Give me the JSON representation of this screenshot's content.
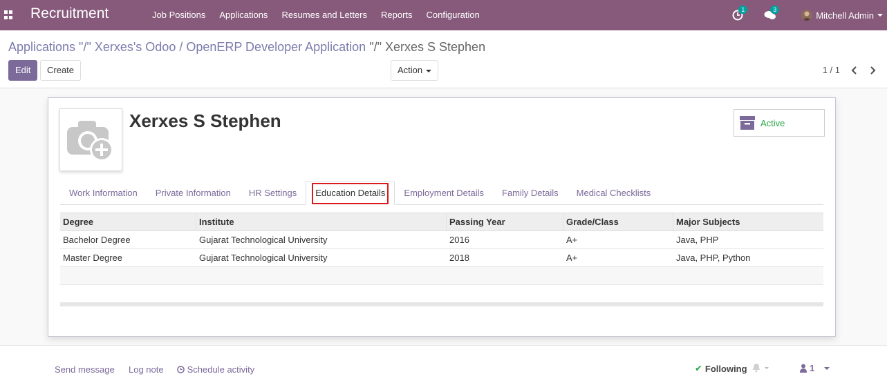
{
  "navbar": {
    "brand": "Recruitment",
    "menu": [
      "Job Positions",
      "Applications",
      "Resumes and Letters",
      "Reports",
      "Configuration"
    ],
    "activity_count": "1",
    "message_count": "3",
    "user": "Mitchell Admin"
  },
  "breadcrumb": {
    "part1": "Applications \"/\" Xerxes's Odoo / OpenERP Developer Application",
    "sep": "\"/\"",
    "current": "Xerxes S Stephen"
  },
  "buttons": {
    "edit": "Edit",
    "create": "Create",
    "action": "Action"
  },
  "pager": {
    "value": "1 / 1"
  },
  "record": {
    "name": "Xerxes S Stephen",
    "status": "Active"
  },
  "tabs": [
    "Work Information",
    "Private Information",
    "HR Settings",
    "Education Details",
    "Employment Details",
    "Family Details",
    "Medical Checklists"
  ],
  "table": {
    "headers": [
      "Degree",
      "Institute",
      "Passing Year",
      "Grade/Class",
      "Major Subjects"
    ],
    "rows": [
      [
        "Bachelor Degree",
        "Gujarat Technological University",
        "2016",
        "A+",
        "Java, PHP"
      ],
      [
        "Master Degree",
        "Gujarat Technological University",
        "2018",
        "A+",
        "Java, PHP, Python"
      ]
    ]
  },
  "chatter": {
    "send_message": "Send message",
    "log_note": "Log note",
    "schedule_activity": "Schedule activity",
    "following": "Following",
    "followers_count": "1"
  },
  "colors": {
    "navbar": "#875a7b",
    "primary": "#7c6a9b",
    "active_green": "#28a745",
    "highlight_red": "#d9191a"
  }
}
